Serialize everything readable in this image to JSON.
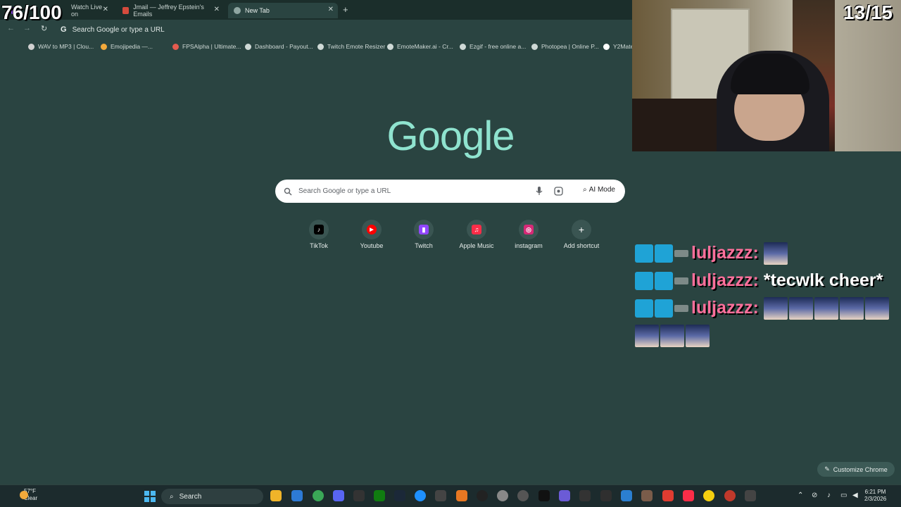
{
  "browser": {
    "tabs": [
      {
        "title": "Watch Live on",
        "favicon_color": "#9146ff",
        "active": false
      },
      {
        "title": "Jmail — Jeffrey Epstein's Emails",
        "favicon_color": "#d54b3d",
        "active": false
      },
      {
        "title": "New Tab",
        "favicon_color": "#8fa6a2",
        "active": true
      }
    ],
    "new_tab_symbol": "+",
    "omnibox_text": "Search Google or type a URL",
    "omnibox_icon": "G",
    "nav": {
      "back": "←",
      "forward": "→",
      "reload": "↻"
    },
    "bookmarks": [
      {
        "label": "WAV to MP3 | Clou...",
        "color": "#d1d1d1"
      },
      {
        "label": "Emojipedia —...",
        "color": "#f2a93b"
      },
      {
        "label": "FPSAlpha | Ultimate...",
        "color": "#e45b4f"
      },
      {
        "label": "Dashboard - Payout...",
        "color": "#cfd9d6"
      },
      {
        "label": "Twitch Emote Resizer",
        "color": "#cfd9d6"
      },
      {
        "label": "EmoteMaker.ai - Cr...",
        "color": "#cfd9d6"
      },
      {
        "label": "Ezgif - free online a...",
        "color": "#cfd9d6"
      },
      {
        "label": "Photopea | Online P...",
        "color": "#cfd9d6"
      },
      {
        "label": "Y2Mate",
        "color": "#ffffff"
      }
    ]
  },
  "ntp": {
    "logo": "Google",
    "search_placeholder": "Search Google or type a URL",
    "ai_mode_label": "AI Mode",
    "shortcuts": [
      {
        "label": "TikTok",
        "icon": "tiktok-icon",
        "color": "#000000",
        "glyph": "♪"
      },
      {
        "label": "Youtube",
        "icon": "youtube-icon",
        "color": "#ff0000",
        "glyph": "▶"
      },
      {
        "label": "Twitch",
        "icon": "twitch-icon",
        "color": "#9146ff",
        "glyph": "▮"
      },
      {
        "label": "Apple Music",
        "icon": "apple-music-icon",
        "color": "#fa2d48",
        "glyph": "♫"
      },
      {
        "label": "instagram",
        "icon": "instagram-icon",
        "color": "#d62976",
        "glyph": "◎"
      },
      {
        "label": "Add shortcut",
        "icon": "plus-icon",
        "color": "#3a5552",
        "glyph": "+"
      }
    ],
    "customize_label": "Customize Chrome"
  },
  "overlay": {
    "counter_left": "76/100",
    "counter_right": "13/15",
    "chat": [
      {
        "user": "luljazzz:",
        "text": "",
        "emotes": 1
      },
      {
        "user": "luljazzz:",
        "text": "*tecwlk cheer*",
        "emotes": 0
      },
      {
        "user": "luljazzz:",
        "text": "",
        "emotes": 8
      }
    ]
  },
  "taskbar": {
    "weather_temp": "57°F",
    "weather_desc": "Clear",
    "search_label": "Search",
    "time": "6:21 PM",
    "date": "2/3/2026"
  }
}
